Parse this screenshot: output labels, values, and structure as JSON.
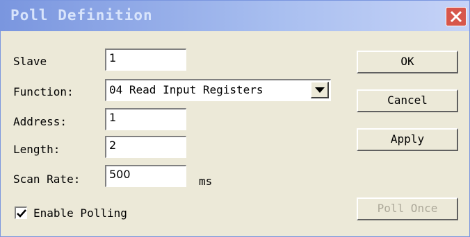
{
  "window": {
    "title": "Poll Definition",
    "close_icon": "close-icon"
  },
  "form": {
    "slave": {
      "label": "Slave",
      "value": "1"
    },
    "function": {
      "label": "Function:",
      "value": "04 Read Input Registers"
    },
    "address": {
      "label": "Address:",
      "value": "1"
    },
    "length": {
      "label": "Length:",
      "value": "2"
    },
    "scan_rate": {
      "label": "Scan Rate:",
      "value": "500",
      "unit": "ms"
    },
    "enable_polling": {
      "label": "Enable Polling",
      "checked": true
    }
  },
  "buttons": {
    "ok": "OK",
    "cancel": "Cancel",
    "apply": "Apply",
    "poll_once": "Poll Once"
  },
  "colors": {
    "titlebar": "#7a96df",
    "close": "#d7564b",
    "dialog_bg": "#ece9d8",
    "disabled_text": "#aca899"
  }
}
